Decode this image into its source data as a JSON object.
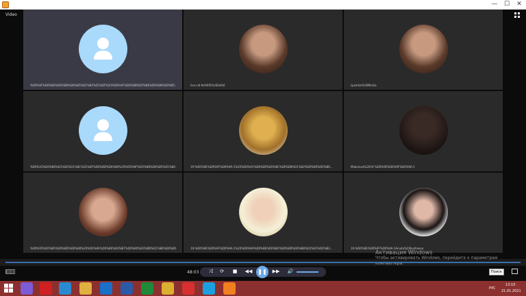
{
  "window": {
    "video_label": "Video"
  },
  "tiles": [
    {
      "type": "placeholder",
      "name": "%D0%9F%D0%B0%D0%B8%D0%B5%D1%82%D1%8F%20%D0%9F%D0%B8%D0%B0%D0%B8%D0%B5...",
      "active": true
    },
    {
      "type": "photo",
      "name": "live.cid.9cfe9501c82efe0"
    },
    {
      "type": "photo",
      "name": "Lyamkin%20Nickia"
    },
    {
      "type": "placeholder",
      "name": "%D0%A2%D0%B0%D1%82%D1%8C%D1%8F%D0%BD%D0%B0%20%D0%9F%D0%B8%D0%B5%D1%80..."
    },
    {
      "type": "photo",
      "name": "19-%D0%9E%D0%9F%D0%9A-1%20%D0%A1%D0%B0%D0%BC%D0%B8%D1%82%D0%B0%D0%B6..."
    },
    {
      "type": "photo",
      "name": "Makarova%2019-%D0%9E%D0%9F%D0%9A-1"
    },
    {
      "type": "photo",
      "name": "%D0%95%D0%B5%D0%BD%D0%B0%20%D0%9A%D0%B0%D0%B7%D0%B0%D0%BD%D1%86%D0%B5..."
    },
    {
      "type": "photo",
      "name": "19-%D0%9E%D0%9F%D0%9A-1%20%D0%9A%D0%BE%D0%B2%D0%B0%D0%BB%D1%91%D0%B2..."
    },
    {
      "type": "photo",
      "name": "19-%D0%9E%D0%9F%D0%9A-1Aniutа%20kuzhaeva"
    }
  ],
  "player": {
    "time": "48:03",
    "seek_fraction": 0.48,
    "volume_fraction": 0.6
  },
  "watermark": {
    "title": "Активация Windows",
    "subtitle": "Чтобы активировать Windows, перейдите к параметрам компьютера."
  },
  "search_tip": "Поиск",
  "tray": {
    "lang": "РУС",
    "time": "13:10",
    "date": "21.01.2021"
  },
  "colors": {
    "accent": "#6fa8e8",
    "taskbar": "#8c2f2f",
    "avatar_placeholder": "#a9d9fb"
  }
}
